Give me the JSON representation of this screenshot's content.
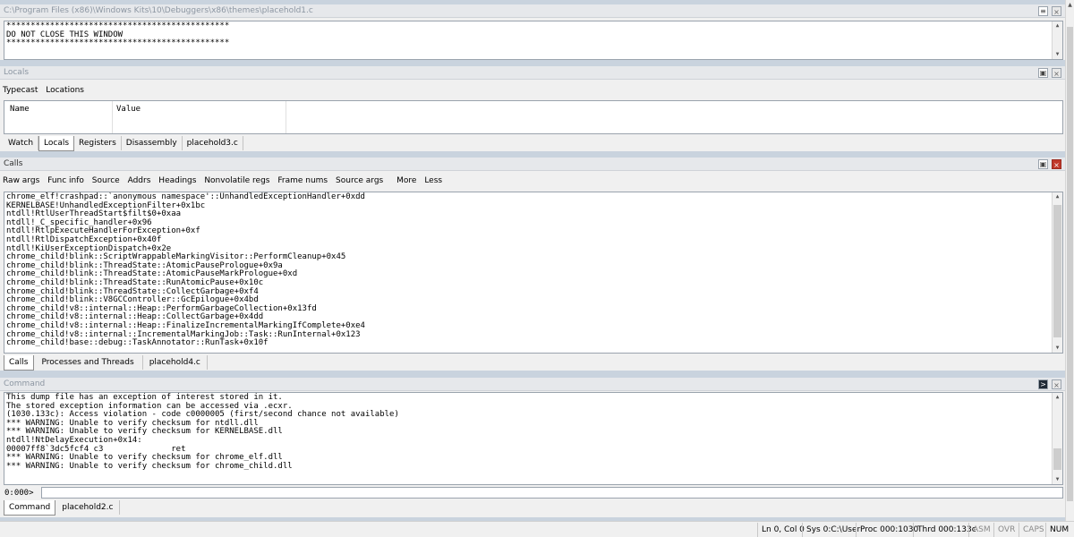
{
  "source_window": {
    "title": "C:\\Program Files (x86)\\Windows Kits\\10\\Debuggers\\x86\\themes\\placehold1.c",
    "lines": [
      "**********************************************",
      "DO NOT CLOSE THIS WINDOW",
      "**********************************************"
    ]
  },
  "locals": {
    "title": "Locals",
    "toolbar": [
      "Typecast",
      "Locations"
    ],
    "col_name": "Name",
    "col_value": "Value",
    "tabs": [
      "Watch",
      "Locals",
      "Registers",
      "Disassembly",
      "placehold3.c"
    ]
  },
  "calls": {
    "title": "Calls",
    "toolbar": [
      "Raw args",
      "Func info",
      "Source",
      "Addrs",
      "Headings",
      "Nonvolatile regs",
      "Frame nums",
      "Source args",
      "More",
      "Less"
    ],
    "frames": [
      "chrome_elf!crashpad::`anonymous namespace'::UnhandledExceptionHandler+0xdd",
      "KERNELBASE!UnhandledExceptionFilter+0x1bc",
      "ntdll!RtlUserThreadStart$filt$0+0xaa",
      "ntdll!_C_specific_handler+0x96",
      "ntdll!RtlpExecuteHandlerForException+0xf",
      "ntdll!RtlDispatchException+0x40f",
      "ntdll!KiUserExceptionDispatch+0x2e",
      "chrome_child!blink::ScriptWrappableMarkingVisitor::PerformCleanup+0x45",
      "chrome_child!blink::ThreadState::AtomicPausePrologue+0x9a",
      "chrome_child!blink::ThreadState::AtomicPauseMarkPrologue+0xd",
      "chrome_child!blink::ThreadState::RunAtomicPause+0x10c",
      "chrome_child!blink::ThreadState::CollectGarbage+0xf4",
      "chrome_child!blink::V8GCController::GcEpilogue+0x4bd",
      "chrome_child!v8::internal::Heap::PerformGarbageCollection+0x13fd",
      "chrome_child!v8::internal::Heap::CollectGarbage+0x4dd",
      "chrome_child!v8::internal::Heap::FinalizeIncrementalMarkingIfComplete+0xe4",
      "chrome_child!v8::internal::IncrementalMarkingJob::Task::RunInternal+0x123",
      "chrome_child!base::debug::TaskAnnotator::RunTask+0x10f"
    ],
    "tabs": [
      "Calls",
      "Processes and Threads",
      "placehold4.c"
    ]
  },
  "command": {
    "title": "Command",
    "output": [
      "This dump file has an exception of interest stored in it.",
      "The stored exception information can be accessed via .ecxr.",
      "(1030.133c): Access violation - code c0000005 (first/second chance not available)",
      "*** WARNING: Unable to verify checksum for ntdll.dll",
      "*** WARNING: Unable to verify checksum for KERNELBASE.dll",
      "ntdll!NtDelayExecution+0x14:",
      "00007ff8`3dc5fcf4 c3              ret",
      "*** WARNING: Unable to verify checksum for chrome_elf.dll",
      "*** WARNING: Unable to verify checksum for chrome_child.dll"
    ],
    "prompt": "0:000>",
    "input_value": "",
    "tabs": [
      "Command",
      "placehold2.c"
    ]
  },
  "statusbar": {
    "position": "Ln 0, Col 0",
    "sys": "Sys 0:C:\\User",
    "proc": "Proc 000:1030",
    "thrd": "Thrd 000:133c",
    "asm": "ASM",
    "ovr": "OVR",
    "caps": "CAPS",
    "num": "NUM"
  },
  "colors": {
    "background": "#c9d3de",
    "panel": "#f0f0f0",
    "close_active": "#c0392b"
  }
}
